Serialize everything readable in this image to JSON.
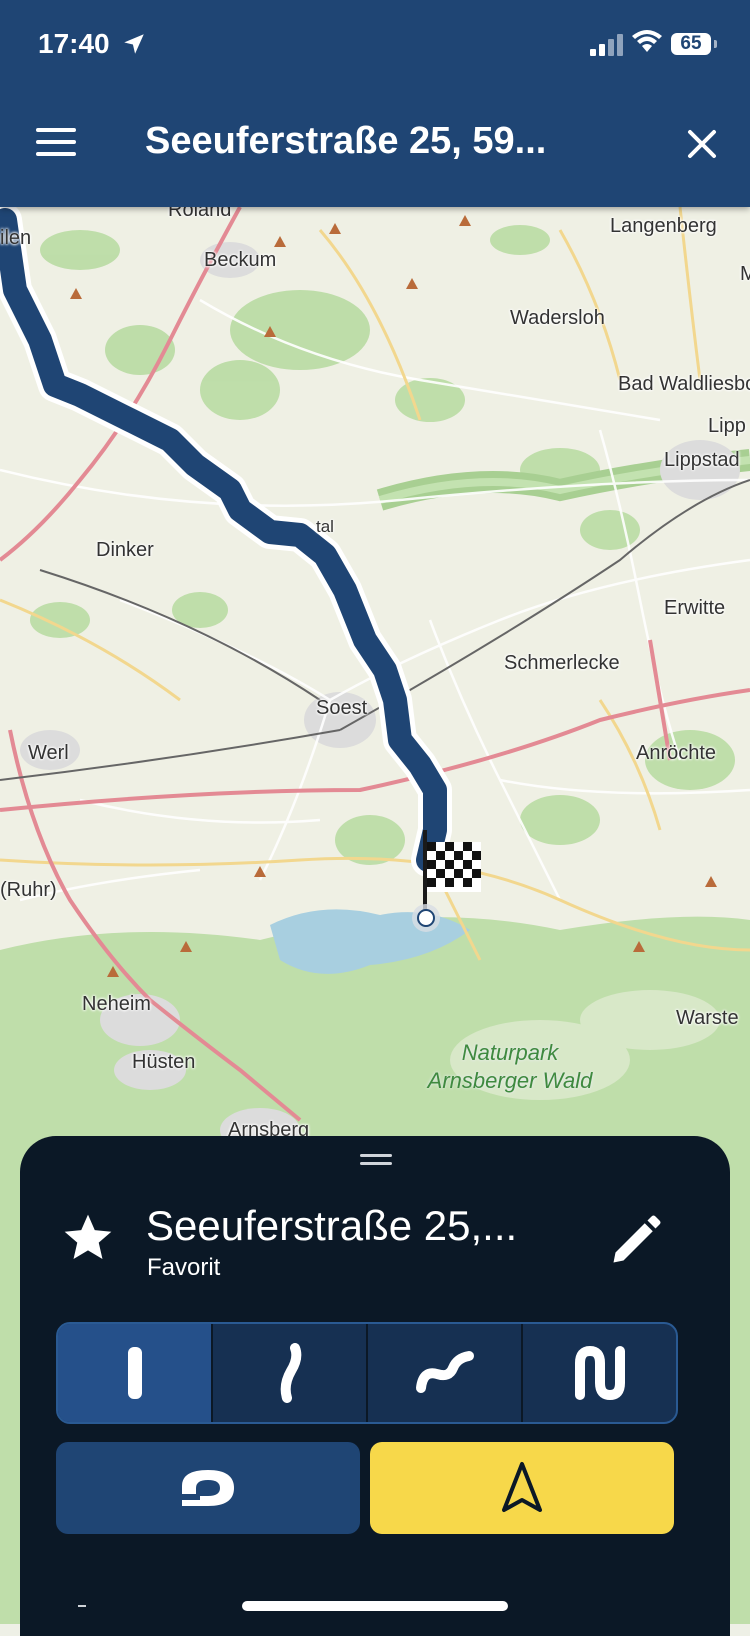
{
  "status_bar": {
    "time": "17:40",
    "battery": "65"
  },
  "header": {
    "title": "Seeuferstraße 25, 59..."
  },
  "map": {
    "places": {
      "roland": "Roland",
      "ilen": "ilen",
      "beckum": "Beckum",
      "langenberg": "Langenberg",
      "m": "M",
      "wadersloh": "Wadersloh",
      "bad_waldliesborn": "Bad Waldliesbo",
      "lipp": "Lipp",
      "lippstadt": "Lippstad",
      "tal": "tal",
      "dinker": "Dinker",
      "erwitte": "Erwitte",
      "schmerlecke": "Schmerlecke",
      "soest": "Soest",
      "werl": "Werl",
      "anroechte": "Anröchte",
      "ruhr": "(Ruhr)",
      "neheim": "Neheim",
      "warstein": "Warste",
      "huesten": "Hüsten",
      "arnsberg": "Arnsberg",
      "park_line1": "Naturpark",
      "park_line2": "Arnsberger Wald"
    },
    "route_color": "#1f4574",
    "flag_icon": "checkered-flag-icon"
  },
  "sheet": {
    "title": "Seeuferstraße 25,...",
    "subtitle": "Favorit",
    "curviness_options": [
      {
        "icon": "straight-road-icon",
        "selected": true
      },
      {
        "icon": "slight-curve-icon",
        "selected": false
      },
      {
        "icon": "curvy-road-icon",
        "selected": false
      },
      {
        "icon": "very-curvy-road-icon",
        "selected": false
      }
    ],
    "route_button_icon": "route-planner-icon",
    "navigate_button_icon": "navigation-arrow-icon",
    "accent_yellow": "#f7d84a"
  }
}
